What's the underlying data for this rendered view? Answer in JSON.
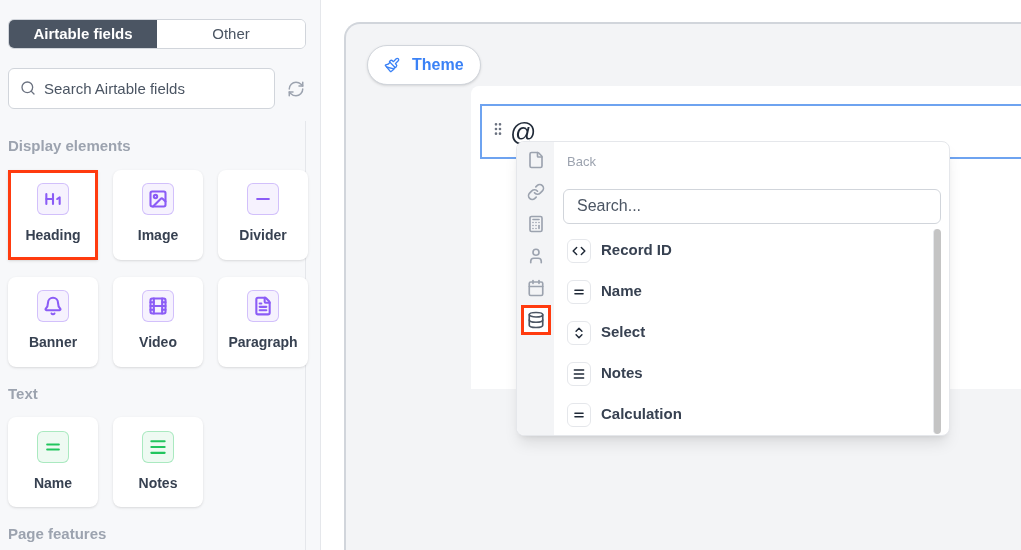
{
  "sidebar": {
    "tabs": [
      {
        "label": "Airtable fields",
        "selected": true
      },
      {
        "label": "Other",
        "selected": false
      }
    ],
    "search": {
      "placeholder": "Search Airtable fields"
    },
    "sections": [
      {
        "title": "Display elements",
        "items": [
          {
            "label": "Heading",
            "kind": "heading",
            "color": "#8b5cf6",
            "highlighted": true
          },
          {
            "label": "Image",
            "kind": "image",
            "color": "#8b5cf6",
            "highlighted": false
          },
          {
            "label": "Divider",
            "kind": "divider",
            "color": "#8b5cf6",
            "highlighted": false
          },
          {
            "label": "Banner",
            "kind": "banner",
            "color": "#8b5cf6",
            "highlighted": false
          },
          {
            "label": "Video",
            "kind": "video",
            "color": "#8b5cf6",
            "highlighted": false
          },
          {
            "label": "Paragraph",
            "kind": "paragraph",
            "color": "#8b5cf6",
            "highlighted": false
          }
        ]
      },
      {
        "title": "Text",
        "items": [
          {
            "label": "Name",
            "kind": "single-line",
            "color": "#22c55e",
            "highlighted": false
          },
          {
            "label": "Notes",
            "kind": "long-text",
            "color": "#22c55e",
            "highlighted": false
          }
        ]
      },
      {
        "title": "Page features"
      }
    ]
  },
  "canvas": {
    "theme_button": "Theme",
    "heading_value": "@",
    "menu": {
      "back": "Back",
      "search": {
        "placeholder": "Search..."
      },
      "categories": [
        {
          "kind": "document",
          "highlighted": false
        },
        {
          "kind": "link",
          "highlighted": false
        },
        {
          "kind": "calculator",
          "highlighted": false
        },
        {
          "kind": "person",
          "highlighted": false
        },
        {
          "kind": "calendar",
          "highlighted": false
        },
        {
          "kind": "database",
          "highlighted": true
        }
      ],
      "fields": [
        {
          "label": "Record ID",
          "kind": "code"
        },
        {
          "label": "Name",
          "kind": "single-line"
        },
        {
          "label": "Select",
          "kind": "select"
        },
        {
          "label": "Notes",
          "kind": "long-text"
        },
        {
          "label": "Calculation",
          "kind": "single-line"
        }
      ]
    }
  }
}
